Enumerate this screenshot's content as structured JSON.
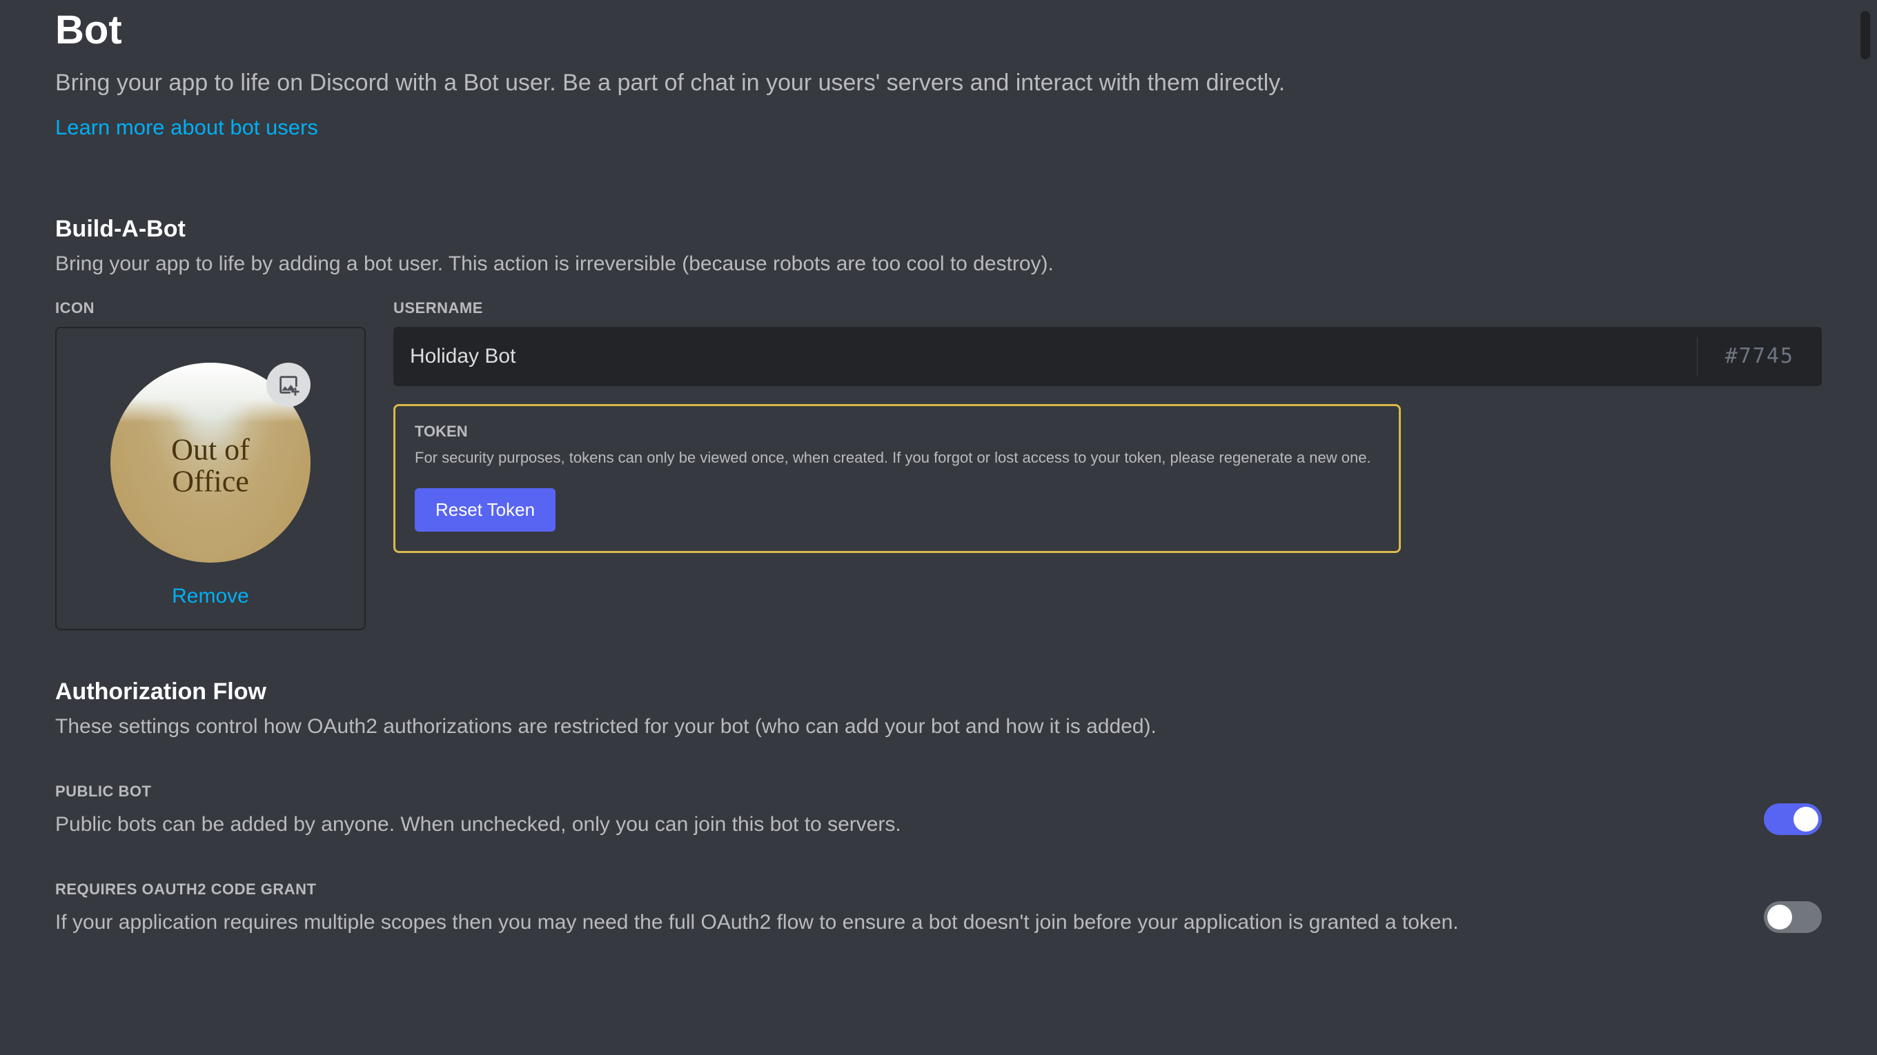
{
  "header": {
    "title": "Bot",
    "subtitle": "Bring your app to life on Discord with a Bot user. Be a part of chat in your users' servers and interact with them directly.",
    "learn_link": "Learn more about bot users"
  },
  "build": {
    "title": "Build-A-Bot",
    "desc": "Bring your app to life by adding a bot user. This action is irreversible (because robots are too cool to destroy).",
    "icon_label": "ICON",
    "avatar_text": "Out of\nOffice",
    "remove": "Remove",
    "username_label": "USERNAME",
    "username_value": "Holiday Bot",
    "discriminator": "#7745",
    "token_label": "TOKEN",
    "token_desc": "For security purposes, tokens can only be viewed once, when created. If you forgot or lost access to your token, please regenerate a new one.",
    "reset_btn": "Reset Token"
  },
  "auth": {
    "title": "Authorization Flow",
    "desc": "These settings control how OAuth2 authorizations are restricted for your bot (who can add your bot and how it is added).",
    "public_bot_label": "PUBLIC BOT",
    "public_bot_desc": "Public bots can be added by anyone. When unchecked, only you can join this bot to servers.",
    "public_bot_on": true,
    "oauth_grant_label": "REQUIRES OAUTH2 CODE GRANT",
    "oauth_grant_desc": "If your application requires multiple scopes then you may need the full OAuth2 flow to ensure a bot doesn't join before your application is granted a token.",
    "oauth_grant_on": false
  }
}
